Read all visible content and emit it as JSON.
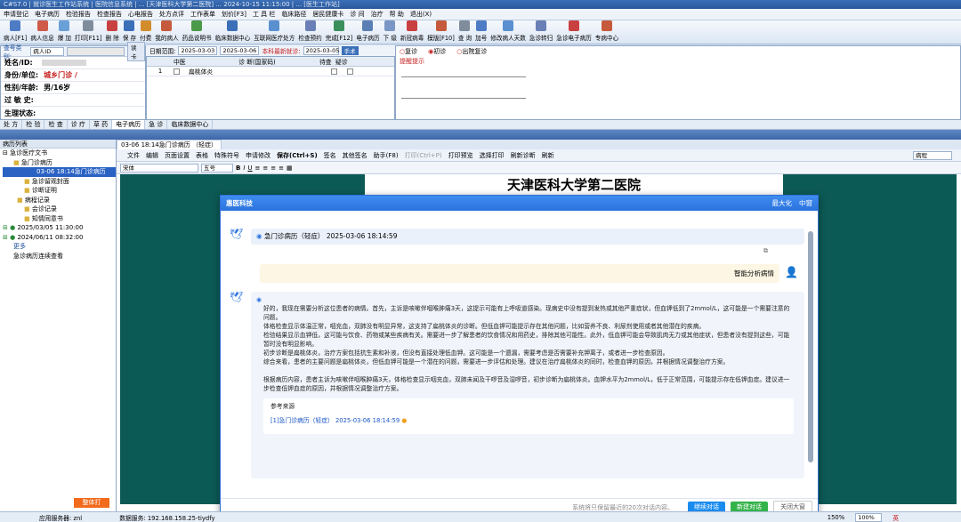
{
  "window": {
    "title": "C#S7.0 | 就诊医生工作站系统 | 医院信息系统 | ... [天津医科大学第二医院] ... 2024-10-15 11:15:00 | ... [医生工作站]"
  },
  "menu": [
    "申请登记",
    "电子病历",
    "检验报告",
    "检查报告",
    "心电报告",
    "处方点评",
    "工作表单",
    "划价[F3]",
    "工 具 栏",
    "临床路径",
    "居民健康卡",
    "诊 间",
    "治疗",
    "帮 助",
    "退出(X)"
  ],
  "toolbar": [
    "病人[F1]",
    "病人信息",
    "爆 加",
    "打印[F11]",
    "删 除",
    "保 存",
    "付费",
    "我的病人",
    "药品说明书",
    "临床数据中心",
    "互联网医疗处方",
    "检查预约",
    "完成[F12]",
    "电子病历",
    "下 级",
    "新冠病毒",
    "模版[F10]",
    "查 询",
    "加号",
    "修改病人天数",
    "急诊转归",
    "急诊电子病历",
    "专病中心"
  ],
  "patient": {
    "id_label": "查号类别:",
    "id_type": "病人ID",
    "name_label": "姓名/ID:",
    "identity_label": "身份/单位:",
    "identity_value": "城乡门诊 /",
    "gender_label": "性别/年龄:",
    "gender_value": "男/16岁",
    "allergy_label": "过 敏 史:",
    "physio_label": "生理状态:",
    "search_btn": "读卡"
  },
  "filter": {
    "date_label": "日期范围:",
    "date_from": "2025-03-03",
    "date_to": "2025-03-06",
    "visit_label": "本科最新就诊:",
    "visit_date": "2025-03-05",
    "btn": "手术"
  },
  "diag_table": {
    "headers": [
      "中医",
      "诊 断(国家码)",
      "待查",
      "疑诊"
    ],
    "rows": [
      {
        "no": "1",
        "name": "扁桃体炎"
      }
    ]
  },
  "visit_options": {
    "opt1": "复诊",
    "opt2": "初诊",
    "opt3": "出院复诊",
    "hint": "提醒提示"
  },
  "tabs": [
    "处 方",
    "检 验",
    "检 查",
    "诊 疗",
    "草 药",
    "电子病历",
    "急 诊",
    "临床数据中心"
  ],
  "section_title": "病历列表",
  "tree": {
    "root": "急诊医疗文书",
    "items": [
      "急门诊病历",
      "03-06 18:14急门诊病历",
      "急诊留观封面",
      "诊断证明",
      "病程记录",
      "会诊记录",
      "知情同意书"
    ],
    "visits": [
      "2025/03/05 11:30:00",
      "2024/06/11 08:32:00"
    ],
    "more": "更多",
    "continuous": "急诊病历连续查看"
  },
  "left_button": "整体打",
  "doc": {
    "tab": "03-06 18:14急门诊病历 （轻症）",
    "menu": [
      "文件",
      "编辑",
      "页面设置",
      "表格",
      "特殊符号",
      "申请修改",
      "保存(Ctrl+S)",
      "签名",
      "其他签名",
      "助手(F8)",
      "打印(Ctrl+P)",
      "打印预览",
      "选择打印",
      "刷新诊断",
      "刷新"
    ],
    "right_select": "病程",
    "font": "宋体",
    "size": "五号",
    "hospital": "天津医科大学第二医院"
  },
  "dialog": {
    "logo": "惠医科技",
    "maximize": "最大化",
    "close": "中窗",
    "msg1": "急门诊病历（轻症） 2025-03-06 18:14:59",
    "user_query": "智能分析病情",
    "answer_p1": "好的，我现在需要分析这位患者的病情。首先，主诉是咳嗽伴咽喉肿痛3天，这提示可能有上呼吸道感染。现病史中没有提到发热或其他严重症状，但血钾低到了2mmol/L，这可能是一个需要注意的问题。",
    "answer_p2": "体格检查显示体温正常，咽充血，双肺没有明显异常，这支持了扁桃体炎的诊断。但低血钾可能提示存在其他问题，比如营养不良、利尿剂使用或者其他潜在的疾病。",
    "answer_p3": "检验结果显示血钾低，这可能与饮食、药物或某些疾病有关。需要进一步了解患者的饮食情况和用药史，排除其他可能性。此外，低血钾可能会导致肌肉无力或其他症状，但患者没有提到这些，可能暂时没有明显影响。",
    "answer_p4": "初步诊断是扁桃体炎，治疗方案包括抗生素和补液，但没有直接处理低血钾。这可能是一个遗漏，需要考虑是否需要补充钾离子，或者进一步检查原因。",
    "answer_p5": "综合来看，患者的主要问题是扁桃体炎，但低血钾可能是一个潜在的问题，需要进一步评估和处理。建议在治疗扁桃体炎的同时，检查血钾的原因，并根据情况调整治疗方案。",
    "answer_p6": "根据病历内容，患者主诉为咳嗽伴咽喉肿痛3天，体格检查显示咽充血，双肺未闻及干啰音及湿啰音，初步诊断为扁桃体炎。血钾水平为2mmol/L，低于正常范围，可能提示存在低钾血症。建议进一步检查低钾血症的原因，并根据情况调整治疗方案。",
    "ref_title": "参考来源",
    "ref_item": "[1]急门诊病历（轻症） 2025-03-06 18:14:59",
    "footer_note": "系统将只保留最近的20次对话内容。",
    "btn_continue": "继续对话",
    "btn_new": "新建对话",
    "btn_close": "关闭大窗"
  },
  "status": {
    "app_server": "应用服务器: znl",
    "db_server": "数据服务: 192.168.158.25-tiydfy",
    "zoom1": "150%",
    "zoom2": "100%",
    "ime": "英"
  }
}
